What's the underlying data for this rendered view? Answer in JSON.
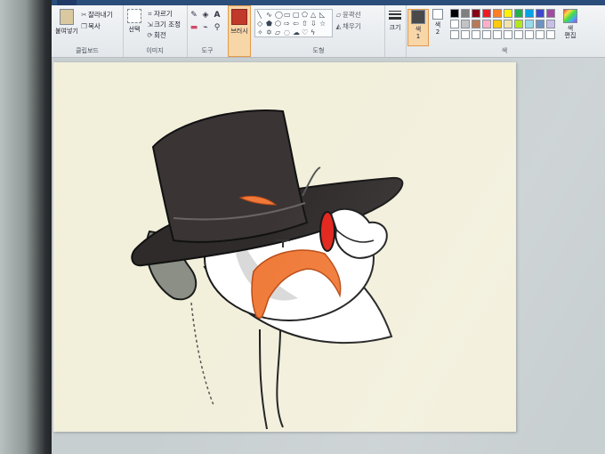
{
  "ribbon": {
    "clipboard": {
      "paste_label": "붙여넣기",
      "cut_label": "잘라내기",
      "copy_label": "복사",
      "group_label": "클립보드"
    },
    "image": {
      "select_label": "선택",
      "crop_label": "자르기",
      "resize_label": "크기 조정",
      "rotate_label": "회전",
      "group_label": "이미지"
    },
    "tools": {
      "group_label": "도구"
    },
    "brushes": {
      "label": "브러시"
    },
    "shapes": {
      "outline_label": "윤곽선",
      "fill_label": "채우기",
      "group_label": "도형"
    },
    "size": {
      "label": "크기"
    },
    "colors": {
      "color1_label": "색\n1",
      "color2_label": "색\n2",
      "edit_label": "색\n편집",
      "group_label": "색",
      "color1_value": "#4a4a4a",
      "color2_value": "#ffffff",
      "palette_row1": [
        "#000000",
        "#7f7f7f",
        "#880015",
        "#ed1c24",
        "#ff7f27",
        "#fff200",
        "#22b14c",
        "#00a2e8",
        "#3f48cc",
        "#a349a4"
      ],
      "palette_row2": [
        "#ffffff",
        "#c3c3c3",
        "#b97a57",
        "#ffaec9",
        "#ffc90e",
        "#efe4b0",
        "#b5e61d",
        "#99d9ea",
        "#7092be",
        "#c8bfe7"
      ],
      "palette_row3": [
        "#ffffff",
        "#ffffff",
        "#ffffff",
        "#ffffff",
        "#ffffff",
        "#ffffff",
        "#ffffff",
        "#ffffff",
        "#ffffff",
        "#ffffff"
      ]
    },
    "accent": "#f0a35a"
  }
}
